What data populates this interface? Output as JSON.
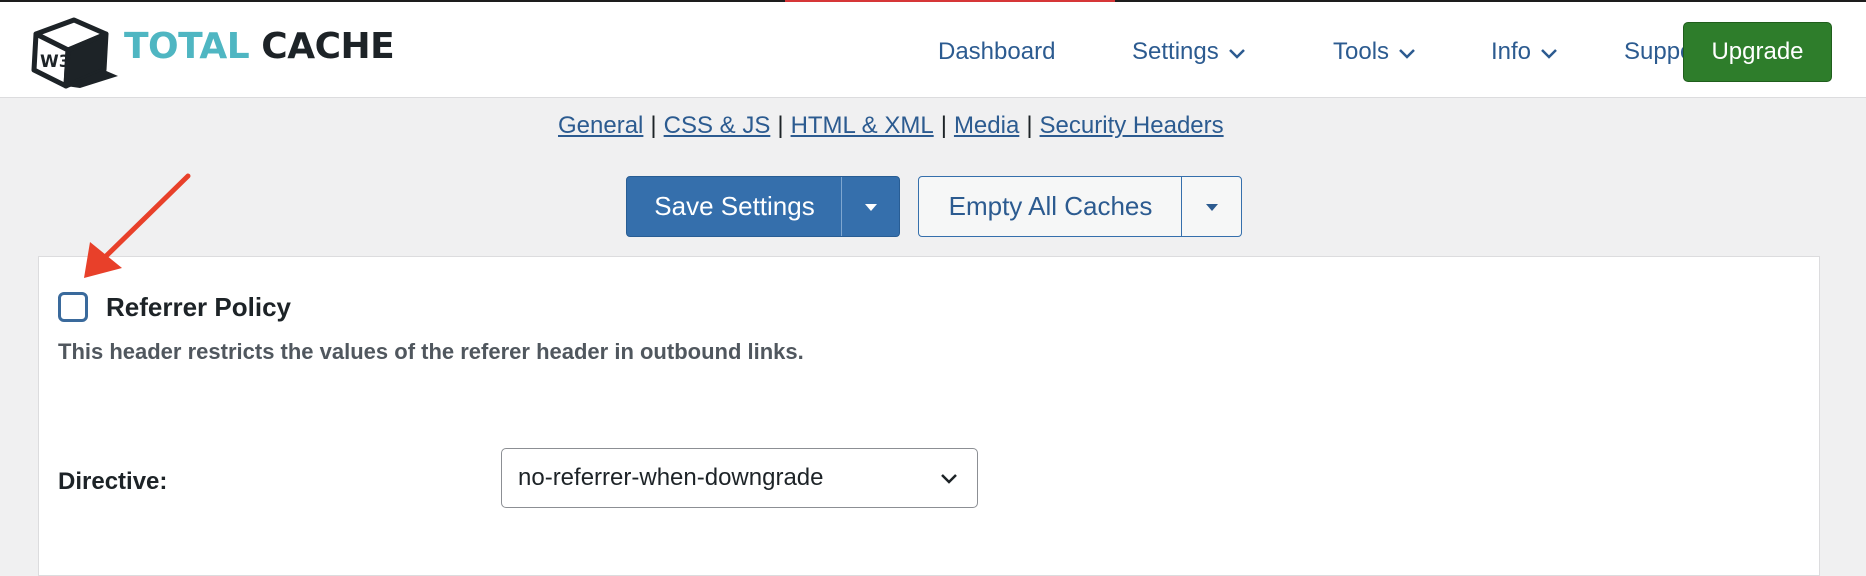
{
  "app": {
    "brand_w3": "W3",
    "brand_total": "TOTAL",
    "brand_cache": "CACHE"
  },
  "nav": {
    "dashboard": "Dashboard",
    "settings": "Settings",
    "tools": "Tools",
    "info": "Info",
    "support": "Support",
    "upgrade": "Upgrade",
    "icons": {
      "dropdown": "chevron-down-icon"
    }
  },
  "subnav": {
    "items": [
      "General",
      "CSS & JS",
      "HTML & XML",
      "Media",
      "Security Headers"
    ],
    "separator": "|"
  },
  "actions": {
    "save_settings": "Save Settings",
    "empty_all_caches": "Empty All Caches"
  },
  "section": {
    "checkbox_label": "Referrer Policy",
    "checkbox_checked": false,
    "description": "This header restricts the values of the referer header in outbound links.",
    "directive_label": "Directive:",
    "directive_value": "no-referrer-when-downgrade"
  },
  "colors": {
    "accent_blue": "#356fac",
    "link_blue": "#2c5b90",
    "upgrade_green": "#2e7d2b",
    "logo_teal": "#4fb6c2",
    "annotation_red": "#e8402a"
  }
}
